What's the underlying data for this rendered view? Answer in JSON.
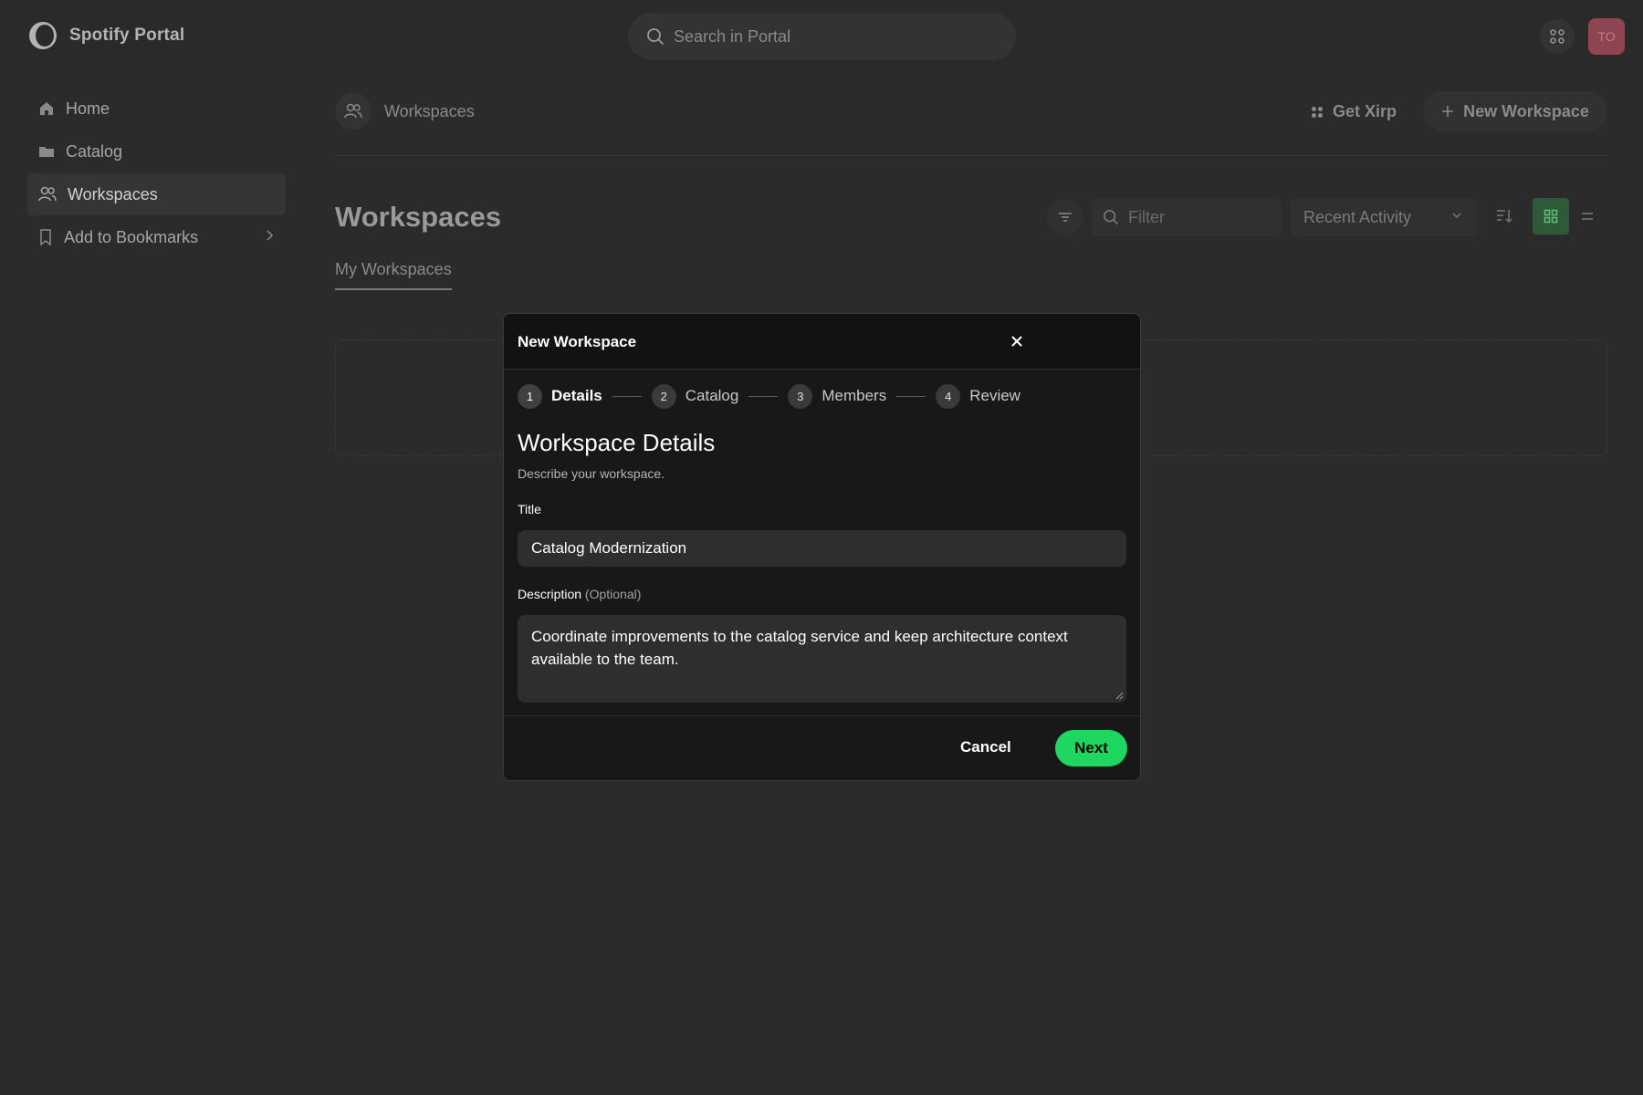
{
  "topbar": {
    "app_name": "Spotify Portal",
    "search_placeholder": "Search in Portal",
    "avatar_initials": "TO"
  },
  "sidebar": {
    "items": [
      {
        "label": "Home",
        "icon": "home-icon"
      },
      {
        "label": "Catalog",
        "icon": "folder-icon"
      },
      {
        "label": "Workspaces",
        "icon": "people-icon",
        "active": true
      },
      {
        "label": "Add to Bookmarks",
        "icon": "bookmark-icon"
      }
    ]
  },
  "main": {
    "breadcrumb": "Workspaces",
    "get_xirp_label": "Get Xirp",
    "new_workspace_label": "New Workspace",
    "page_title": "Workspaces",
    "filter_placeholder": "Filter",
    "sort_value": "Recent Activity",
    "tab_label": "My Workspaces"
  },
  "modal": {
    "title": "New Workspace",
    "steps": [
      {
        "num": "1",
        "label": "Details",
        "current": true
      },
      {
        "num": "2",
        "label": "Catalog"
      },
      {
        "num": "3",
        "label": "Members"
      },
      {
        "num": "4",
        "label": "Review"
      }
    ],
    "section_title": "Workspace Details",
    "section_subtitle": "Describe your workspace.",
    "title_label": "Title",
    "title_value": "Catalog Modernization",
    "description_label": "Description",
    "description_optional": "(Optional)",
    "description_value": "Coordinate improvements to the catalog service and keep architecture context available to the team.",
    "cancel_label": "Cancel",
    "next_label": "Next"
  },
  "colors": {
    "accent": "#1ed760",
    "background": "#2a2a2a",
    "modal_bg": "#181818"
  }
}
